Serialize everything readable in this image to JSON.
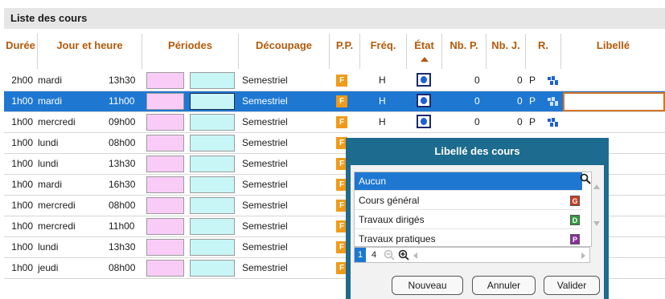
{
  "title": "Liste des cours",
  "columns": {
    "duree": "Durée",
    "jour": "Jour et heure",
    "periodes": "Périodes",
    "decoupage": "Découpage",
    "pp": "P.P.",
    "freq": "Fréq.",
    "etat": "État",
    "nbp": "Nb. P.",
    "nbj": "Nb. J.",
    "r": "R.",
    "libelle": "Libellé"
  },
  "rows": [
    {
      "duree": "2h00",
      "jour": "mardi",
      "heure": "13h30",
      "decoupage": "Semestriel",
      "pp": "F",
      "freq": "H",
      "nbp": "0",
      "nbj": "0",
      "r": "P"
    },
    {
      "duree": "1h00",
      "jour": "mardi",
      "heure": "11h00",
      "decoupage": "Semestriel",
      "pp": "F",
      "freq": "H",
      "nbp": "0",
      "nbj": "0",
      "r": "P"
    },
    {
      "duree": "1h00",
      "jour": "mercredi",
      "heure": "09h00",
      "decoupage": "Semestriel",
      "pp": "F",
      "freq": "H",
      "nbp": "0",
      "nbj": "0",
      "r": "P"
    },
    {
      "duree": "1h00",
      "jour": "lundi",
      "heure": "08h00",
      "decoupage": "Semestriel",
      "pp": "F"
    },
    {
      "duree": "1h00",
      "jour": "lundi",
      "heure": "13h30",
      "decoupage": "Semestriel",
      "pp": "F"
    },
    {
      "duree": "1h00",
      "jour": "mardi",
      "heure": "16h30",
      "decoupage": "Semestriel",
      "pp": "F"
    },
    {
      "duree": "1h00",
      "jour": "mercredi",
      "heure": "08h00",
      "decoupage": "Semestriel",
      "pp": "F"
    },
    {
      "duree": "1h00",
      "jour": "mercredi",
      "heure": "11h00",
      "decoupage": "Semestriel",
      "pp": "F"
    },
    {
      "duree": "1h00",
      "jour": "lundi",
      "heure": "13h30",
      "decoupage": "Semestriel",
      "pp": "F"
    },
    {
      "duree": "1h00",
      "jour": "jeudi",
      "heure": "08h00",
      "decoupage": "Semestriel",
      "pp": "F"
    }
  ],
  "selected_row": 1,
  "popup": {
    "title": "Libellé des cours",
    "items": [
      {
        "label": "Aucun",
        "badge": "",
        "color": ""
      },
      {
        "label": "Cours général",
        "badge": "G",
        "color": "#d03a1e"
      },
      {
        "label": "Travaux dirigés",
        "badge": "D",
        "color": "#2e9a3a"
      },
      {
        "label": "Travaux pratiques",
        "badge": "P",
        "color": "#8a2ea0"
      }
    ],
    "pager": {
      "page_a": "1",
      "page_b": "4"
    },
    "buttons": {
      "nouveau": "Nouveau",
      "annuler": "Annuler",
      "valider": "Valider"
    }
  },
  "colors": {
    "accent": "#1e78d2",
    "header_text": "#b35a0a",
    "popup": "#1d6b8e"
  }
}
